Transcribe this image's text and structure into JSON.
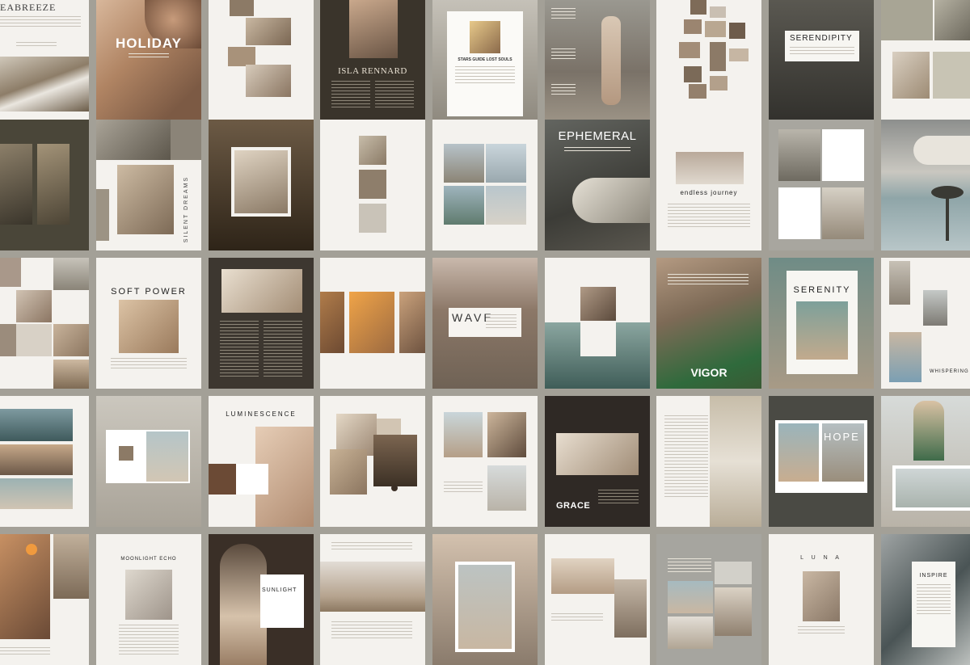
{
  "tiles": {
    "seabreeze": "EABREEZE",
    "holiday": "HOLIDAY",
    "isla": "ISLA RENNARD",
    "stars": "STARS GUIDE LOST SOULS",
    "serendipity": "SERENDIPITY",
    "silent": "SILENT DREAMS",
    "ephemeral": "EPHEMERAL",
    "endless": "endless journey",
    "softpower": "SOFT POWER",
    "wave": "WAVE",
    "serenity": "SERENITY",
    "vigor": "VIGOR",
    "whispering": "WHISPERING",
    "luminescence": "LUMINESCENCE",
    "grace": "GRACE",
    "hope": "HOPE",
    "moonlight": "MOONLIGHT ECHO",
    "sunlight": "SUNLIGHT",
    "luna": "L U N A",
    "inspire": "INSPIRE"
  }
}
